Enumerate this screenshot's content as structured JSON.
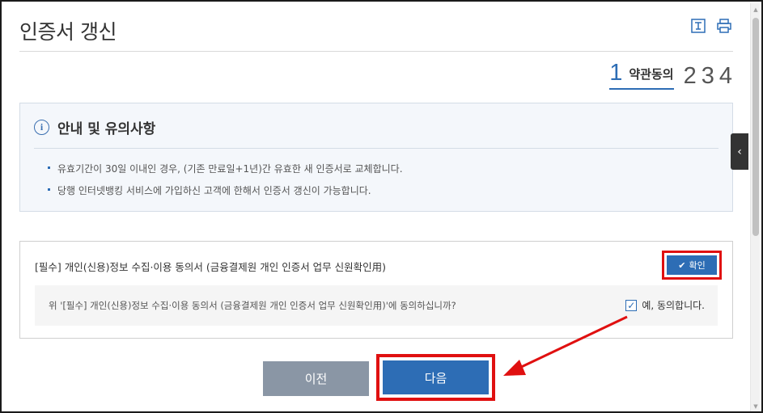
{
  "page": {
    "title": "인증서 갱신"
  },
  "toolbar": {
    "icons": [
      "text-size-icon",
      "print-icon"
    ]
  },
  "steps": {
    "current": {
      "number": "1",
      "label": "약관동의"
    },
    "others": [
      "2",
      "3",
      "4"
    ]
  },
  "notice": {
    "title": "안내 및 유의사항",
    "items": [
      "유효기간이 30일 이내인 경우, (기존 만료일+1년)간 유효한 새 인증서로 교체합니다.",
      "당행 인터넷뱅킹 서비스에 가입하신 고객에 한해서 인증서 갱신이 가능합니다."
    ]
  },
  "consent": {
    "title": "[필수] 개인(신용)정보 수집·이용 동의서 (금융결제원 개인 인증서 업무 신원확인用)",
    "confirm_label": "확인",
    "question": "위 '[필수] 개인(신용)정보 수집·이용 동의서 (금융결제원 개인 인증서 업무 신원확인用)'에 동의하십니까?",
    "agree_label": "예, 동의합니다.",
    "agree_checked": true
  },
  "buttons": {
    "prev_label": "이전",
    "next_label": "다음"
  },
  "colors": {
    "accent": "#2d6db5",
    "prev_button": "#8a96a5",
    "highlight": "#e01010",
    "notice_bg": "#f4f7fb"
  }
}
